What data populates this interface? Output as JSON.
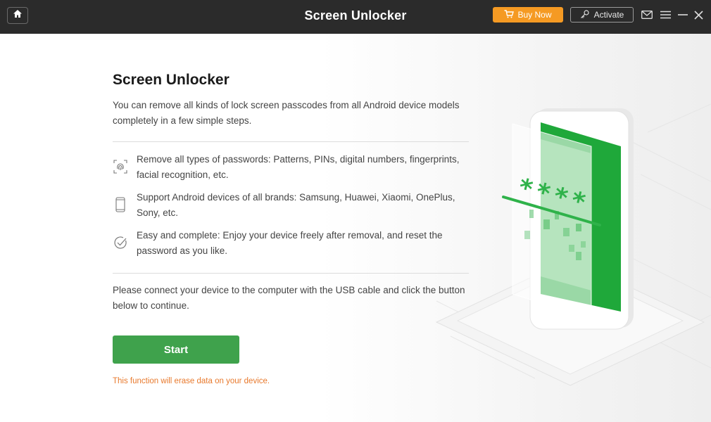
{
  "titlebar": {
    "title": "Screen Unlocker",
    "buy_label": "Buy Now",
    "activate_label": "Activate"
  },
  "main": {
    "heading": "Screen Unlocker",
    "intro": "You can remove all kinds of lock screen passcodes from all Android device models completely in a few simple steps.",
    "features": [
      {
        "icon": "fingerprint-icon",
        "text": "Remove all types of passwords: Patterns, PINs, digital numbers, fingerprints, facial recognition, etc."
      },
      {
        "icon": "phone-icon",
        "text": "Support Android devices of all brands: Samsung, Huawei, Xiaomi, OnePlus, Sony, etc."
      },
      {
        "icon": "check-circle-icon",
        "text": "Easy and complete: Enjoy your device freely after removal, and reset the password as you like."
      }
    ],
    "connect_text": "Please connect your device to the computer with the USB cable and click the button below to continue.",
    "start_label": "Start",
    "warning": "This function will erase data on your device."
  },
  "illustration": {
    "password_mask": "****"
  },
  "colors": {
    "titlebar_bg": "#2b2b2b",
    "accent_green": "#3fa24c",
    "buy_orange": "#f59a23",
    "warning_orange": "#e8792c"
  }
}
